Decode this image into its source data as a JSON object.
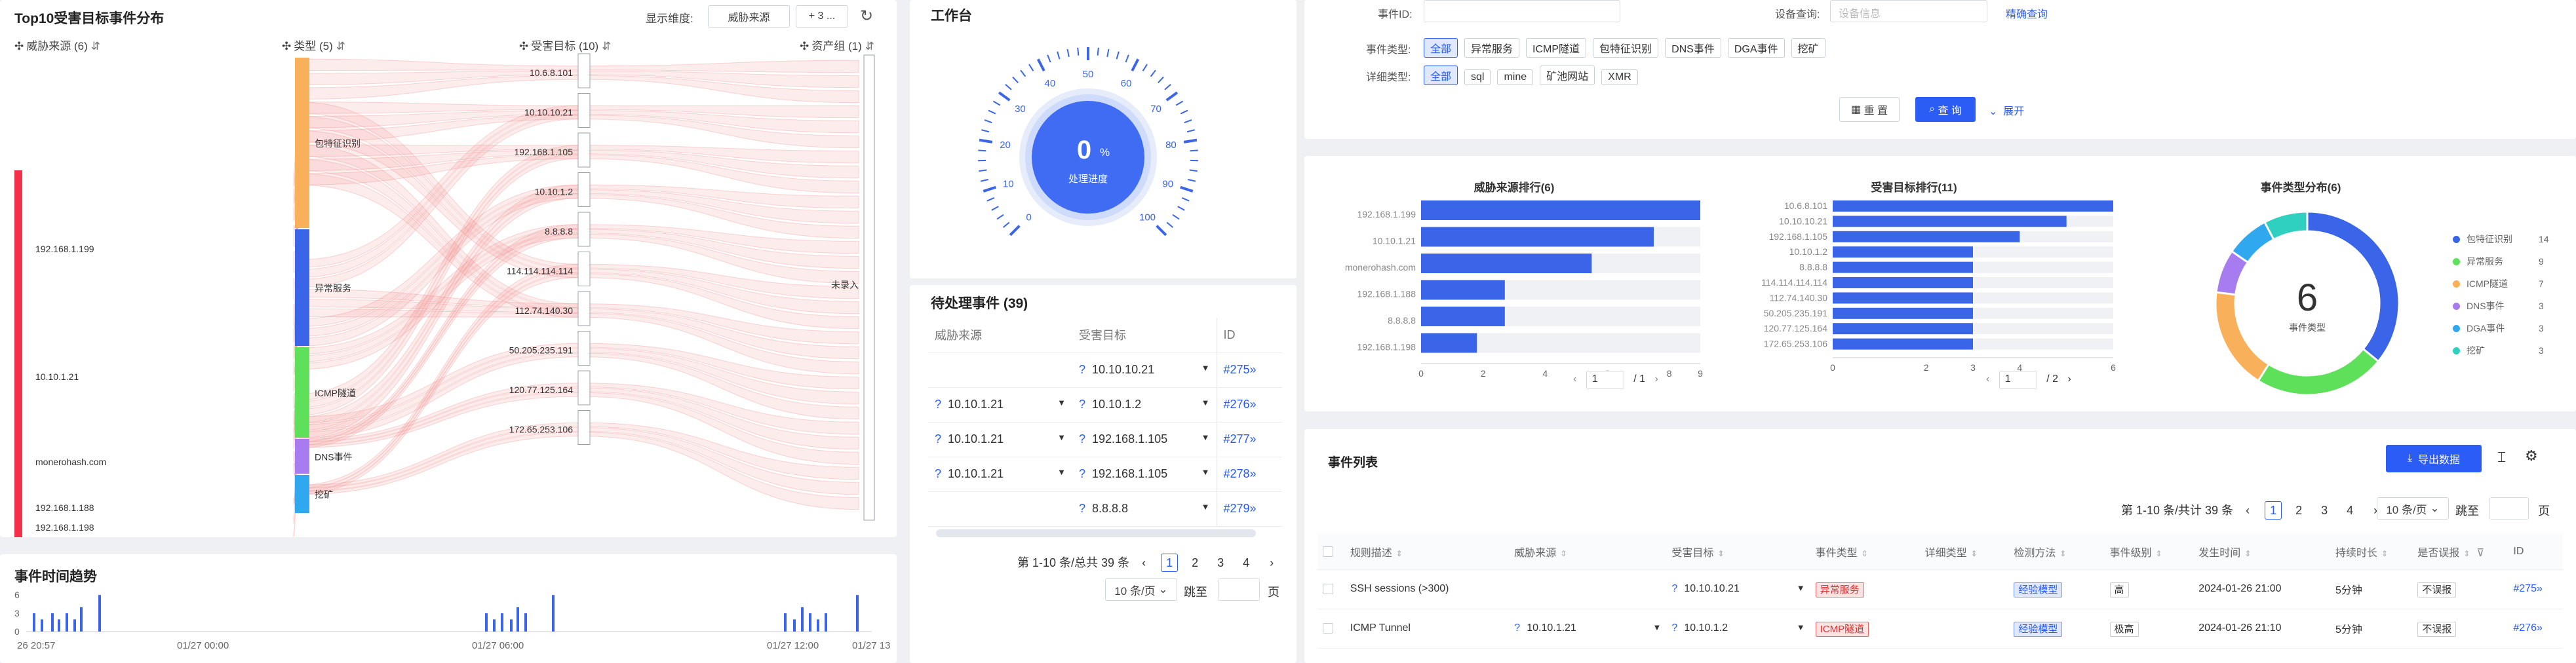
{
  "sankey": {
    "title": "Top10受害目标事件分布",
    "dim_label": "显示维度:",
    "dim_value": "威胁来源",
    "dim_more": "+ 3 ...",
    "col_headers": [
      "威胁来源 (6)",
      "类型 (5)",
      "受害目标 (10)",
      "资产组 (1)"
    ],
    "sources": [
      "192.168.1.199",
      "10.10.1.21",
      "monerohash.com",
      "192.168.1.188",
      "192.168.1.198"
    ],
    "types": [
      "包特征识别",
      "异常服务",
      "ICMP隧道",
      "DNS事件",
      "挖矿"
    ],
    "type_colors": [
      "#f9b05a",
      "#3a65e8",
      "#5fe05a",
      "#a77cf0",
      "#2fa8f0"
    ],
    "targets": [
      "10.6.8.101",
      "10.10.10.21",
      "192.168.1.105",
      "10.10.1.2",
      "8.8.8.8",
      "114.114.114.114",
      "112.74.140.30",
      "50.205.235.191",
      "120.77.125.164",
      "172.65.253.106"
    ],
    "asset_groups": [
      "未录入"
    ]
  },
  "trend": {
    "title": "事件时间趋势",
    "y_ticks": [
      "6",
      "3",
      "0"
    ],
    "x_ticks": [
      "26 20:57",
      "01/27 00:00",
      "01/27 06:00",
      "01/27 12:00",
      "01/27 13"
    ]
  },
  "workbench": {
    "title": "工作台",
    "gauge_value": "0",
    "gauge_unit": "%",
    "gauge_label": "处理进度",
    "gauge_ticks": [
      "0",
      "10",
      "20",
      "30",
      "40",
      "50",
      "60",
      "70",
      "80",
      "90",
      "100"
    ]
  },
  "pending": {
    "title": "待处理事件 (39)",
    "headers": [
      "威胁来源",
      "受害目标",
      "ID"
    ],
    "rows": [
      {
        "src": "",
        "dst": "10.10.10.21",
        "id": "#275"
      },
      {
        "src": "10.10.1.21",
        "dst": "10.10.1.2",
        "id": "#276"
      },
      {
        "src": "10.10.1.21",
        "dst": "192.168.1.105",
        "id": "#277"
      },
      {
        "src": "10.10.1.21",
        "dst": "192.168.1.105",
        "id": "#278"
      },
      {
        "src": "",
        "dst": "8.8.8.8",
        "id": "#279"
      }
    ],
    "page_info": "第 1-10 条/总共 39 条",
    "pages": [
      "1",
      "2",
      "3",
      "4"
    ],
    "page_size": "10 条/页",
    "jump": "跳至",
    "page_unit": "页"
  },
  "filter": {
    "event_id_label": "事件ID:",
    "device_label": "设备查询:",
    "device_placeholder": "设备信息",
    "precise": "精确查询",
    "event_type_label": "事件类型:",
    "event_types": [
      "全部",
      "异常服务",
      "ICMP隧道",
      "包特征识别",
      "DNS事件",
      "DGA事件",
      "挖矿"
    ],
    "detail_type_label": "详细类型:",
    "detail_types": [
      "全部",
      "sql",
      "mine",
      "矿池网站",
      "XMR"
    ],
    "reset": "重 置",
    "search": "查 询",
    "expand": "展开"
  },
  "rankings": {
    "threat_title": "威胁来源排行(6)",
    "threat": {
      "labels": [
        "192.168.1.199",
        "10.10.1.21",
        "monerohash.com",
        "192.168.1.188",
        "8.8.8.8",
        "192.168.1.198"
      ],
      "values": [
        9,
        7.5,
        5.5,
        2.7,
        2.7,
        1.8
      ],
      "ticks": [
        "0",
        "2",
        "4",
        "6",
        "8",
        "9"
      ],
      "max": 9,
      "page": "1",
      "total": "/ 1"
    },
    "victim_title": "受害目标排行(11)",
    "victim": {
      "labels": [
        "10.6.8.101",
        "10.10.10.21",
        "192.168.1.105",
        "10.10.1.2",
        "8.8.8.8",
        "114.114.114.114",
        "112.74.140.30",
        "50.205.235.191",
        "120.77.125.164",
        "172.65.253.106"
      ],
      "values": [
        6,
        5,
        4,
        3,
        3,
        3,
        3,
        3,
        3,
        3
      ],
      "ticks": [
        "0",
        "2",
        "3",
        "4",
        "6"
      ],
      "max": 6,
      "page": "1",
      "total": "/ 2"
    },
    "type_title": "事件类型分布(6)",
    "donut_center": "6",
    "donut_label": "事件类型",
    "legend": [
      {
        "name": "包特征识别",
        "value": "14",
        "color": "#3a65e8"
      },
      {
        "name": "异常服务",
        "value": "9",
        "color": "#5fe05a"
      },
      {
        "name": "ICMP隧道",
        "value": "7",
        "color": "#f9b05a"
      },
      {
        "name": "DNS事件",
        "value": "3",
        "color": "#a77cf0"
      },
      {
        "name": "DGA事件",
        "value": "3",
        "color": "#2fa8f0"
      },
      {
        "name": "挖矿",
        "value": "3",
        "color": "#2fd0c0"
      }
    ]
  },
  "events": {
    "title": "事件列表",
    "export": "导出数据",
    "page_info": "第 1-10 条/共计 39 条",
    "pages": [
      "1",
      "2",
      "3",
      "4"
    ],
    "page_size": "10 条/页",
    "jump": "跳至",
    "page_unit": "页",
    "headers": [
      "规则描述",
      "威胁来源",
      "受害目标",
      "事件类型",
      "详细类型",
      "检测方法",
      "事件级别",
      "发生时间",
      "持续时长",
      "是否误报",
      "ID"
    ],
    "rows": [
      {
        "desc": "SSH sessions (>300)",
        "src": "",
        "dst": "10.10.10.21",
        "type": "异常服务",
        "detail": "",
        "method": "经验模型",
        "level": "高",
        "time": "2024-01-26 21:00",
        "dur": "5分钟",
        "fp": "不误报",
        "id": "#275"
      },
      {
        "desc": "ICMP Tunnel",
        "src": "10.10.1.21",
        "dst": "10.10.1.2",
        "type": "ICMP隧道",
        "detail": "",
        "method": "经验模型",
        "level": "极高",
        "time": "2024-01-26 21:10",
        "dur": "5分钟",
        "fp": "不误报",
        "id": "#276"
      }
    ]
  }
}
